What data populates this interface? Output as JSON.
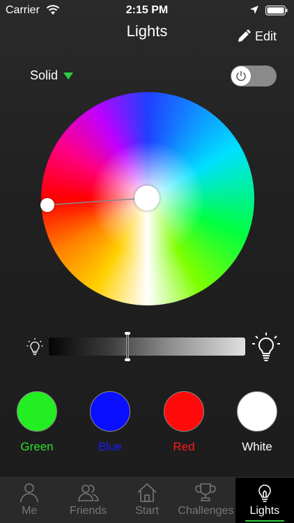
{
  "status_bar": {
    "carrier": "Carrier",
    "time": "2:15 PM"
  },
  "nav": {
    "title": "Lights",
    "edit_label": "Edit"
  },
  "mode": {
    "label": "Solid"
  },
  "power": {
    "on": false
  },
  "brightness": {
    "level": 0.4
  },
  "presets": [
    {
      "label": "Green",
      "color": "#22ee22",
      "label_color": "#2ee02e"
    },
    {
      "label": "Blue",
      "color": "#0a10ff",
      "label_color": "#1a1aff"
    },
    {
      "label": "Red",
      "color": "#ff0a0a",
      "label_color": "#ff1a1a"
    },
    {
      "label": "White",
      "color": "#ffffff",
      "label_color": "#ffffff"
    }
  ],
  "tabs": [
    {
      "label": "Me",
      "icon": "person-icon"
    },
    {
      "label": "Friends",
      "icon": "friends-icon"
    },
    {
      "label": "Start",
      "icon": "home-icon"
    },
    {
      "label": "Challenges",
      "icon": "trophy-icon"
    },
    {
      "label": "Lights",
      "icon": "lightbulb-icon",
      "active": true
    }
  ],
  "colors": {
    "accent": "#2ecc40"
  }
}
